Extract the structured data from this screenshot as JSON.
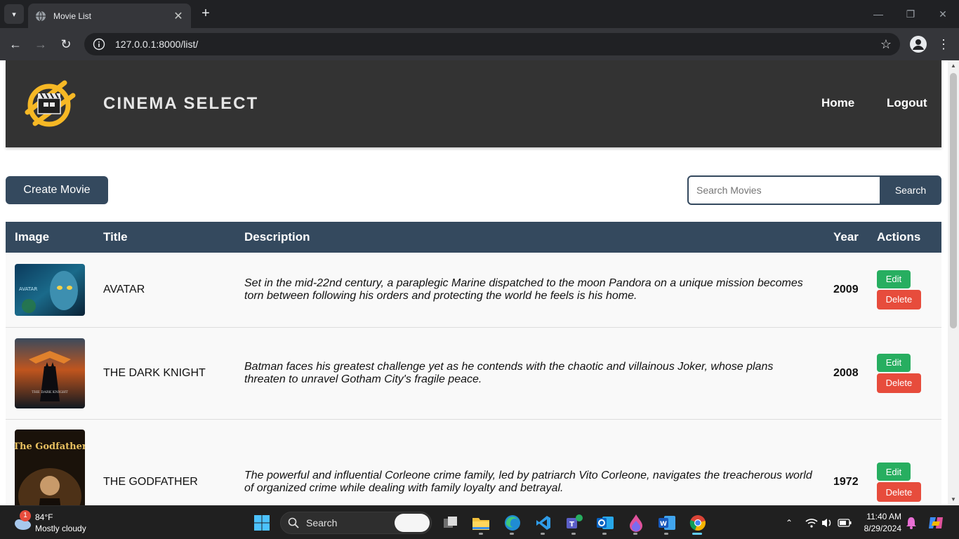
{
  "browser": {
    "tab_title": "Movie List",
    "url": "127.0.0.1:8000/list/"
  },
  "site": {
    "brand": "CINEMA SELECT",
    "nav": [
      "Home",
      "Logout"
    ],
    "create_button": "Create Movie",
    "search_placeholder": "Search Movies",
    "search_button": "Search"
  },
  "table": {
    "headers": [
      "Image",
      "Title",
      "Description",
      "Year",
      "Actions"
    ],
    "rows": [
      {
        "title": "AVATAR",
        "description": "Set in the mid-22nd century, a paraplegic Marine dispatched to the moon Pandora on a unique mission becomes torn between following his orders and protecting the world he feels is his home.",
        "year": "2009",
        "poster_text": "AVATAR",
        "edit": "Edit",
        "delete": "Delete"
      },
      {
        "title": "THE DARK KNIGHT",
        "description": "Batman faces his greatest challenge yet as he contends with the chaotic and villainous Joker, whose plans threaten to unravel Gotham City's fragile peace.",
        "year": "2008",
        "poster_text": "THE DARK KNIGHT",
        "edit": "Edit",
        "delete": "Delete"
      },
      {
        "title": "THE GODFATHER",
        "description": "The powerful and influential Corleone crime family, led by patriarch Vito Corleone, navigates the treacherous world of organized crime while dealing with family loyalty and betrayal.",
        "year": "1972",
        "poster_text": "The Godfather",
        "edit": "Edit",
        "delete": "Delete"
      }
    ]
  },
  "taskbar": {
    "weather_temp": "84°F",
    "weather_desc": "Mostly cloudy",
    "weather_badge": "1",
    "search_label": "Search",
    "time": "11:40 AM",
    "date": "8/29/2024"
  },
  "colors": {
    "header_bg": "#333333",
    "primary": "#34495e",
    "edit": "#27ae60",
    "delete": "#e74c3c"
  }
}
